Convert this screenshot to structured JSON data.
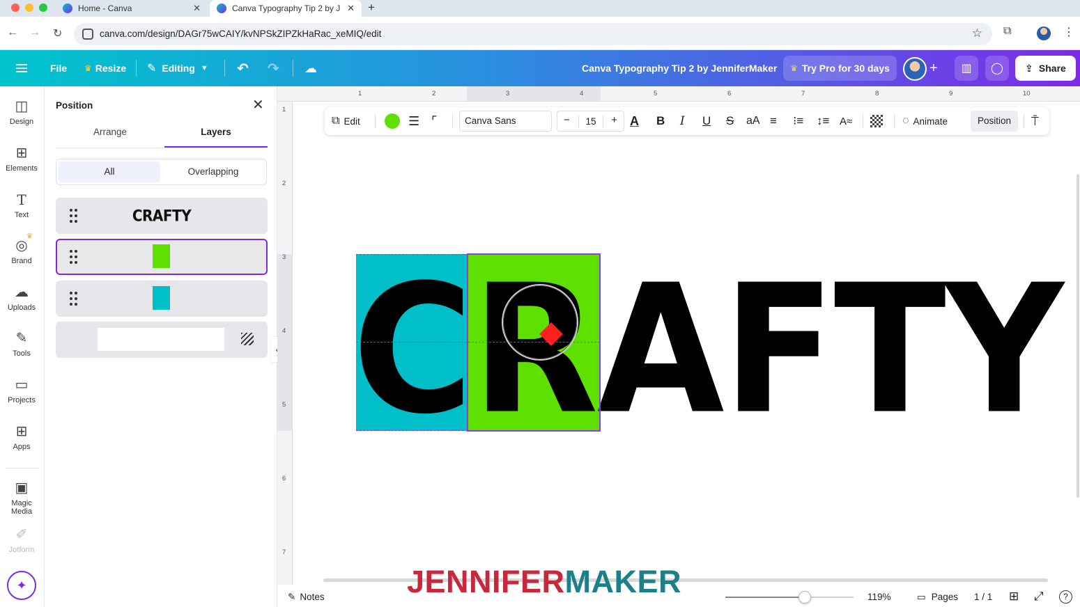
{
  "browser": {
    "tabs": [
      {
        "title": "Home - Canva",
        "active": false
      },
      {
        "title": "Canva Typography Tip 2 by J",
        "active": true
      }
    ],
    "url": "canva.com/design/DAGr75wCAIY/kvNPSkZIPZkHaRac_xeMIQ/edit"
  },
  "header": {
    "file_label": "File",
    "resize_label": "Resize",
    "editing_label": "Editing",
    "doc_title": "Canva Typography Tip 2 by JenniferMaker",
    "pro_label": "Try Pro for 30 days",
    "share_label": "Share"
  },
  "rail": {
    "items": [
      {
        "label": "Design",
        "icon": "design-icon"
      },
      {
        "label": "Elements",
        "icon": "elements-icon"
      },
      {
        "label": "Text",
        "icon": "text-icon"
      },
      {
        "label": "Brand",
        "icon": "brand-icon"
      },
      {
        "label": "Uploads",
        "icon": "uploads-icon"
      },
      {
        "label": "Tools",
        "icon": "tools-icon"
      },
      {
        "label": "Projects",
        "icon": "projects-icon"
      },
      {
        "label": "Apps",
        "icon": "apps-icon"
      },
      {
        "label": "Magic Media",
        "icon": "magic-media-icon"
      },
      {
        "label": "Jotform",
        "icon": "jotform-icon"
      }
    ]
  },
  "panel": {
    "title": "Position",
    "tabs": [
      "Arrange",
      "Layers"
    ],
    "active_tab": "Layers",
    "filters": [
      "All",
      "Overlapping"
    ],
    "active_filter": "All",
    "layers": [
      {
        "kind": "text",
        "label": "CRAFTY"
      },
      {
        "kind": "shape",
        "color": "#5EE000",
        "selected": true
      },
      {
        "kind": "shape",
        "color": "#00BFC9"
      },
      {
        "kind": "background",
        "color": "#FFFFFF"
      }
    ]
  },
  "ruler": {
    "h_ticks": [
      "1",
      "2",
      "3",
      "4",
      "5",
      "6",
      "7",
      "8",
      "9",
      "10"
    ],
    "v_ticks": [
      "1",
      "2",
      "3",
      "4",
      "5",
      "6",
      "7"
    ]
  },
  "toolbar": {
    "edit_label": "Edit",
    "text_color": "#5EE000",
    "font_name": "Canva Sans",
    "font_size": "15",
    "animate_label": "Animate",
    "position_label": "Position"
  },
  "design": {
    "text": "CRAFTY",
    "text_color": "#000000",
    "rect_colors": [
      "#00BFC9",
      "#5EE000"
    ]
  },
  "watermark": {
    "part1": "JENNIFER",
    "part2": "MAKER"
  },
  "bottom": {
    "notes_label": "Notes",
    "zoom_fraction": 0.62,
    "zoom_label": "119%",
    "pages_label": "Pages",
    "page_count": "1 / 1"
  }
}
